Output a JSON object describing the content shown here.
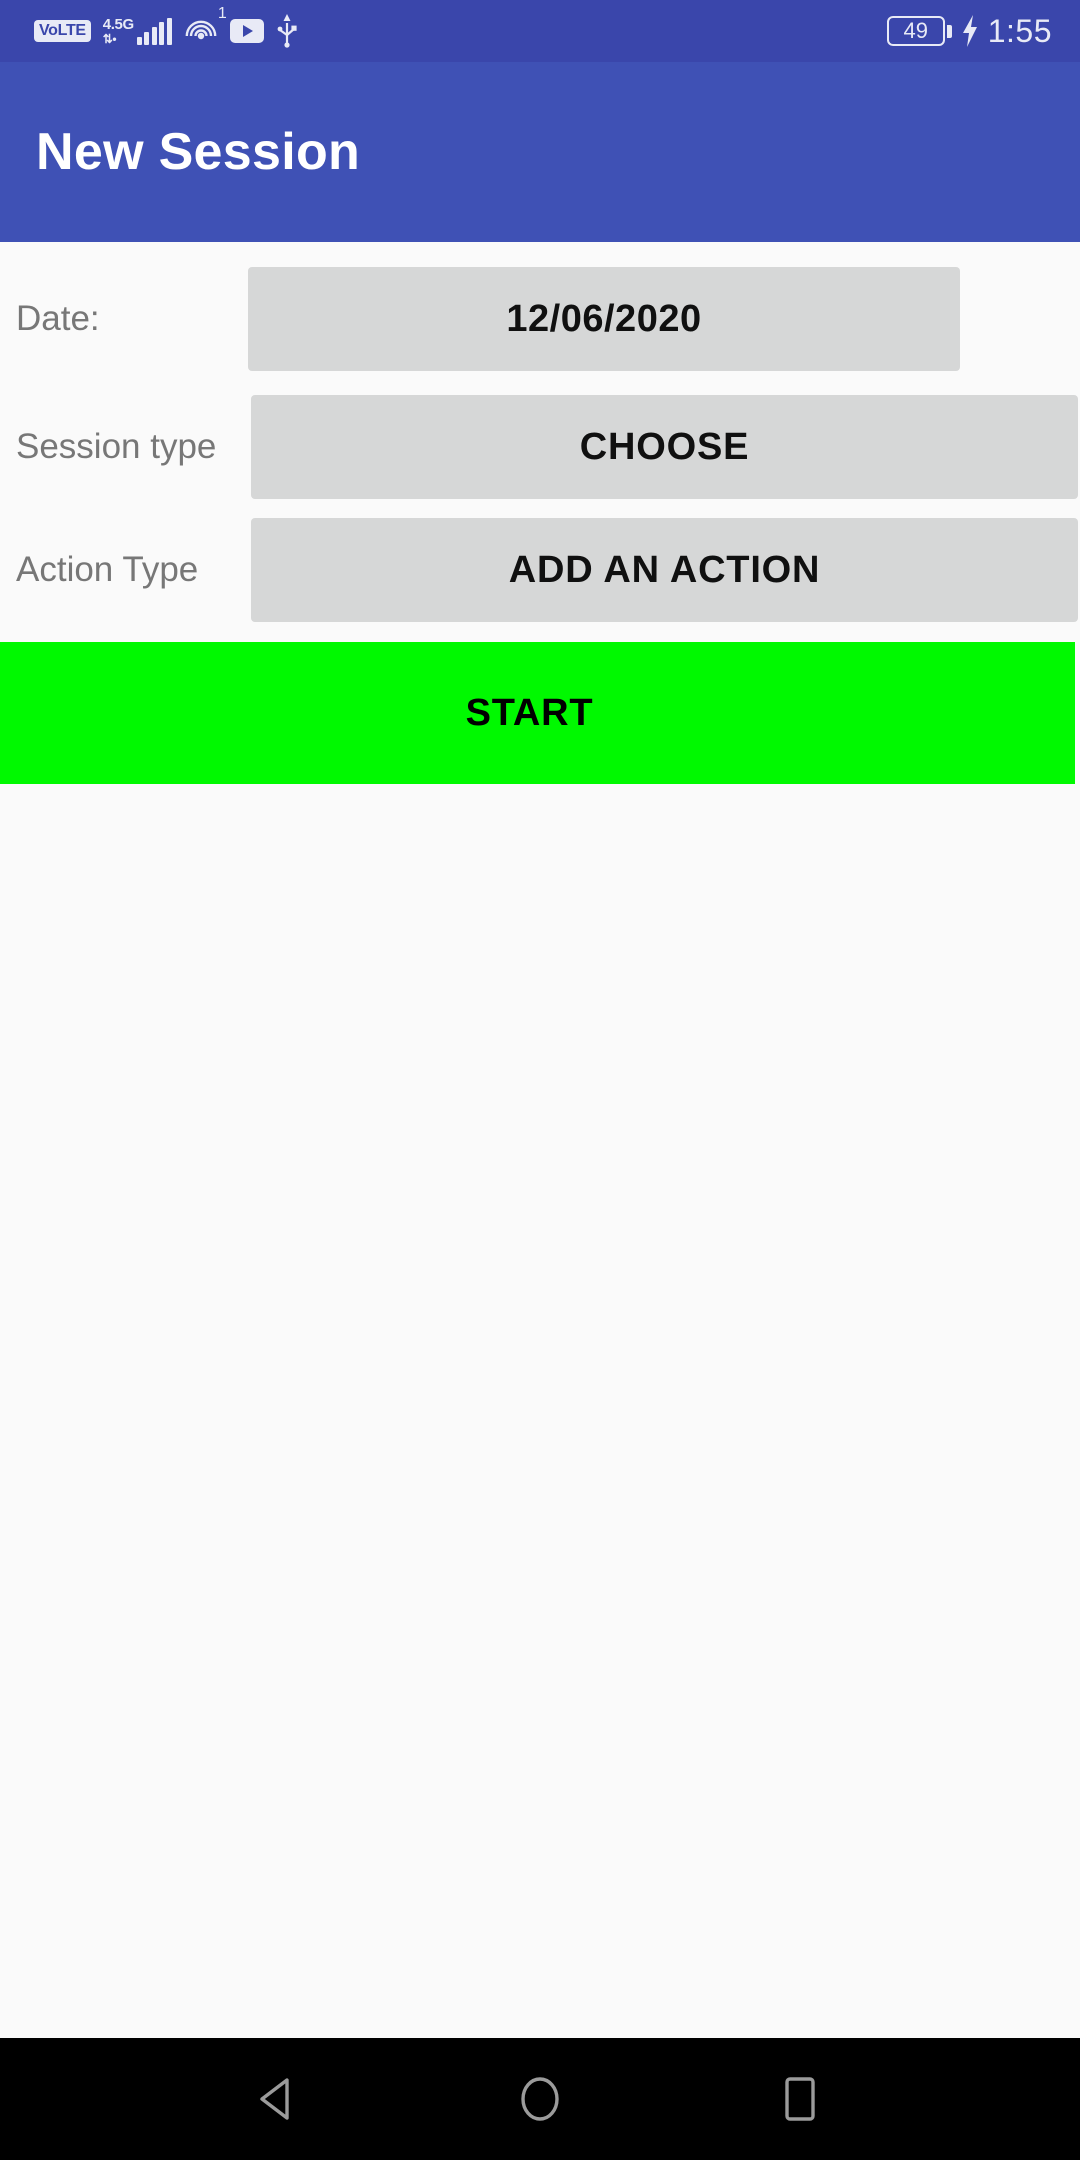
{
  "status_bar": {
    "volte_label": "VoLTE",
    "network_generation": "4.5G",
    "network_arrows": "⇅",
    "signal_icon": "signal-bars-icon",
    "hotspot_icon": "hotspot-icon",
    "hotspot_count": "1",
    "youtube_icon": "youtube-icon",
    "usb_icon": "usb-icon",
    "battery_percent": "49",
    "charging_icon": "charging-bolt-icon",
    "time": "1:55",
    "background_color": "#3a46ab",
    "foreground_color": "#e8eaf6"
  },
  "app_bar": {
    "title": "New Session",
    "background_color": "#3f51b5",
    "title_color": "#ffffff"
  },
  "form": {
    "rows": [
      {
        "label": "Date:",
        "button_label": "12/06/2020",
        "button_name": "date-button"
      },
      {
        "label": "Session type",
        "button_label": "CHOOSE",
        "button_name": "session-choose-button"
      },
      {
        "label": "Action Type",
        "button_label": "ADD AN ACTION",
        "button_name": "action-add-button"
      }
    ],
    "button_color": "#d6d7d7",
    "label_color": "#777777"
  },
  "start_button": {
    "label": "START",
    "background_color": "#00f900",
    "text_color": "#000000"
  },
  "nav_bar": {
    "back_icon": "back-triangle-icon",
    "home_icon": "home-circle-icon",
    "recents_icon": "recents-square-icon",
    "background_color": "#000000",
    "icon_color": "#9b9b9b"
  }
}
